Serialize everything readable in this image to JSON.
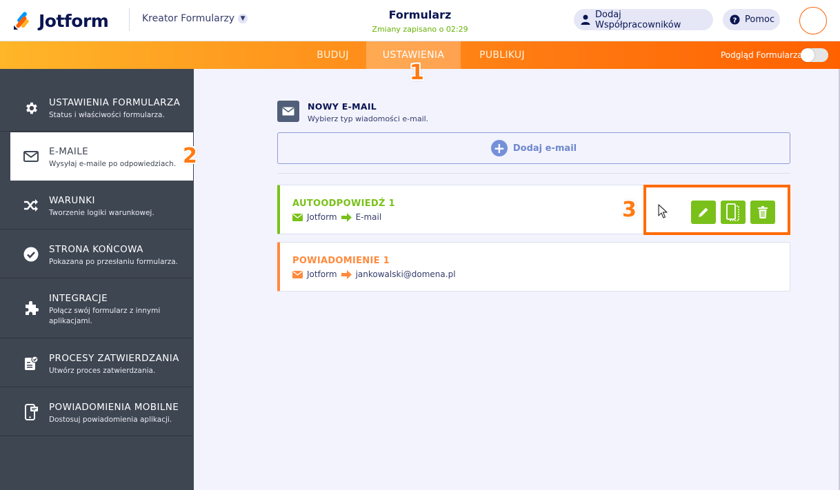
{
  "header": {
    "logo_text": "Jotform",
    "builder_menu": "Kreator Formularzy",
    "form_title": "Formularz",
    "saved_status": "Zmiany zapisano o 02:29",
    "add_collaborators": "Dodaj Współpracowników",
    "help": "Pomoc"
  },
  "nav": {
    "tabs": [
      "BUDUJ",
      "USTAWIENIA",
      "PUBLIKUJ"
    ],
    "active_tab": "USTAWIENIA",
    "preview_label": "Podgląd Formularza",
    "preview_enabled": false
  },
  "sidebar": {
    "items": [
      {
        "title": "USTAWIENIA FORMULARZA",
        "desc": "Status i właściwości formularza.",
        "icon": "gear-icon"
      },
      {
        "title": "E-MAILE",
        "desc": "Wysyłaj e-maile po odpowiedziach.",
        "icon": "envelope-icon"
      },
      {
        "title": "WARUNKI",
        "desc": "Tworzenie logiki warunkowej.",
        "icon": "shuffle-icon"
      },
      {
        "title": "STRONA KOŃCOWA",
        "desc": "Pokazana po przesłaniu formularza.",
        "icon": "check-circle-icon"
      },
      {
        "title": "INTEGRACJE",
        "desc": "Połącz swój formularz z innymi aplikacjami.",
        "icon": "puzzle-icon"
      },
      {
        "title": "PROCESY ZATWIERDZANIA",
        "desc": "Utwórz proces zatwierdzania.",
        "icon": "approval-doc-icon"
      },
      {
        "title": "POWIADOMIENIA MOBILNE",
        "desc": "Dostosuj powiadomienia aplikacji.",
        "icon": "mobile-notification-icon"
      }
    ],
    "active_index": 1
  },
  "steps": [
    "1",
    "2",
    "3"
  ],
  "main": {
    "new_email": {
      "title": "NOWY E-MAIL",
      "subtitle": "Wybierz typ wiadomości e-mail.",
      "add_button": "Dodaj e-mail"
    },
    "emails": [
      {
        "title": "AUTOODPOWIEDŹ 1",
        "from": "Jotform",
        "to": "E-mail",
        "color": "#79c11a"
      },
      {
        "title": "POWIADOMIENIE 1",
        "from": "Jotform",
        "to": "jankowalski@domena.pl",
        "color": "#ff8a3d"
      }
    ]
  },
  "colors": {
    "accent_orange": "#ff6100",
    "success_green": "#79c11a",
    "sidebar_bg": "#3e4652",
    "navy": "#0a1551"
  }
}
